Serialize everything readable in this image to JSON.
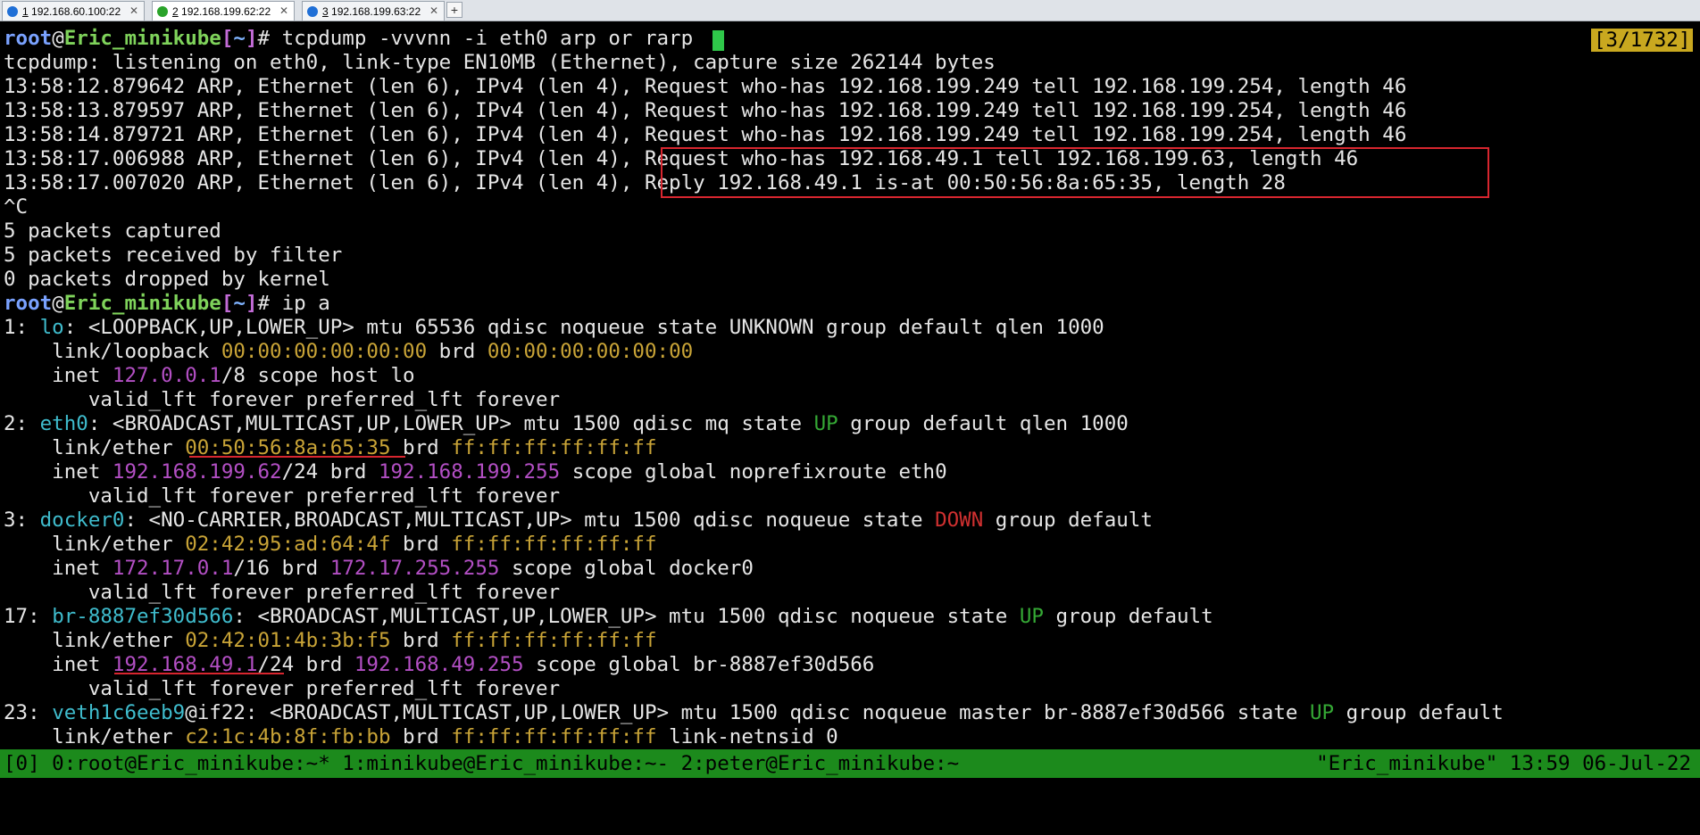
{
  "tabs": [
    {
      "index": "1",
      "label": "192.168.60.100:22",
      "icon": "info-icon",
      "color": "#1f6fd6"
    },
    {
      "index": "2",
      "label": "192.168.199.62:22",
      "icon": "connected-icon",
      "color": "#2aa32a"
    },
    {
      "index": "3",
      "label": "192.168.199.63:22",
      "icon": "info-icon",
      "color": "#1f6fd6"
    }
  ],
  "terminal": {
    "user": "root",
    "host": "Eric_minikube",
    "cwd": "~",
    "cmd1": "tcpdump -vvvnn -i eth0 arp or rarp",
    "counter": "[3/1732]",
    "tcpdump_header": "tcpdump: listening on eth0, link-type EN10MB (Ethernet), capture size 262144 bytes",
    "packets": [
      {
        "prefix": "13:58:12.879642 ARP, Ethernet (len 6), IPv4 (len 4), ",
        "body": "Request who-has 192.168.199.249 tell 192.168.199.254, length 46"
      },
      {
        "prefix": "13:58:13.879597 ARP, Ethernet (len 6), IPv4 (len 4), ",
        "body": "Request who-has 192.168.199.249 tell 192.168.199.254, length 46"
      },
      {
        "prefix": "13:58:14.879721 ARP, Ethernet (len 6), IPv4 (len 4), ",
        "body": "Request who-has 192.168.199.249 tell 192.168.199.254, length 46"
      },
      {
        "prefix": "13:58:17.006988 ARP, Ethernet (len 6), IPv4 (len 4), ",
        "body": "Request who-has 192.168.49.1 tell 192.168.199.63, length 46"
      },
      {
        "prefix": "13:58:17.007020 ARP, Ethernet (len 6), IPv4 (len 4), ",
        "body": "Reply 192.168.49.1 is-at 00:50:56:8a:65:35, length 28"
      }
    ],
    "interrupt": "^C",
    "stats": [
      "5 packets captured",
      "5 packets received by filter",
      "0 packets dropped by kernel"
    ],
    "cmd2": "ip a",
    "ifaces": {
      "lo": {
        "num": "1: ",
        "name": "lo",
        "flags": ": <LOOPBACK,UP,LOWER_UP> mtu 65536 qdisc noqueue state UNKNOWN group default qlen 1000",
        "link_prefix": "    link/loopback ",
        "mac": "00:00:00:00:00:00",
        "brd_word": " brd ",
        "brd_mac": "00:00:00:00:00:00",
        "inet_prefix": "    inet ",
        "ip": "127.0.0.1",
        "ip_rest": "/8 scope host lo",
        "valid": "       valid_lft forever preferred_lft forever"
      },
      "eth0": {
        "num": "2: ",
        "name": "eth0",
        "flags_a": ": <BROADCAST,MULTICAST,UP,LOWER_UP> mtu 1500 qdisc mq state ",
        "state": "UP",
        "flags_b": " group default qlen 1000",
        "link_prefix": "    link/ether ",
        "mac": "00:50:56:8a:65:35",
        "brd_word": " brd ",
        "brd_mac": "ff:ff:ff:ff:ff:ff",
        "inet_prefix": "    inet ",
        "ip": "192.168.199.62",
        "ip_mid": "/24 brd ",
        "brd_ip": "192.168.199.255",
        "ip_rest": " scope global noprefixroute eth0",
        "valid": "       valid_lft forever preferred_lft forever"
      },
      "docker0": {
        "num": "3: ",
        "name": "docker0",
        "flags_a": ": <NO-CARRIER,BROADCAST,MULTICAST,UP> mtu 1500 qdisc noqueue state ",
        "state": "DOWN",
        "flags_b": " group default",
        "link_prefix": "    link/ether ",
        "mac": "02:42:95:ad:64:4f",
        "brd_word": " brd ",
        "brd_mac": "ff:ff:ff:ff:ff:ff",
        "inet_prefix": "    inet ",
        "ip": "172.17.0.1",
        "ip_mid": "/16 brd ",
        "brd_ip": "172.17.255.255",
        "ip_rest": " scope global docker0",
        "valid": "       valid_lft forever preferred_lft forever"
      },
      "br": {
        "num": "17: ",
        "name": "br-8887ef30d566",
        "flags_a": ": <BROADCAST,MULTICAST,UP,LOWER_UP> mtu 1500 qdisc noqueue state ",
        "state": "UP",
        "flags_b": " group default",
        "link_prefix": "    link/ether ",
        "mac": "02:42:01:4b:3b:f5",
        "brd_word": " brd ",
        "brd_mac": "ff:ff:ff:ff:ff:ff",
        "inet_prefix": "    inet ",
        "ip": "192.168.49.1",
        "ip_mid": "/24 brd ",
        "brd_ip": "192.168.49.255",
        "ip_rest": " scope global br-8887ef30d566",
        "valid": "       valid_lft forever preferred_lft forever"
      },
      "veth": {
        "num": "23: ",
        "name": "veth1c6eeb9",
        "flags_a": "@if22: <BROADCAST,MULTICAST,UP,LOWER_UP> mtu 1500 qdisc noqueue master br-8887ef30d566 state ",
        "state": "UP",
        "flags_b": " group default",
        "link_prefix": "    link/ether ",
        "mac": "c2:1c:4b:8f:fb:bb",
        "brd_word": " brd ",
        "brd_mac": "ff:ff:ff:ff:ff:ff",
        "link_rest": " link-netnsid 0"
      }
    }
  },
  "statusbar": {
    "left": "[0] 0:root@Eric_minikube:~* 1:minikube@Eric_minikube:~- 2:peter@Eric_minikube:~",
    "right": "\"Eric_minikube\" 13:59 06-Jul-22"
  },
  "colors": {
    "background": "#000000",
    "statusbar": "#1c8a1c",
    "highlight": "#d8262f",
    "mac": "#c9a437",
    "ip": "#b34fc4",
    "iface": "#3fbccd",
    "state_up": "#35a935",
    "state_down": "#d03030"
  }
}
